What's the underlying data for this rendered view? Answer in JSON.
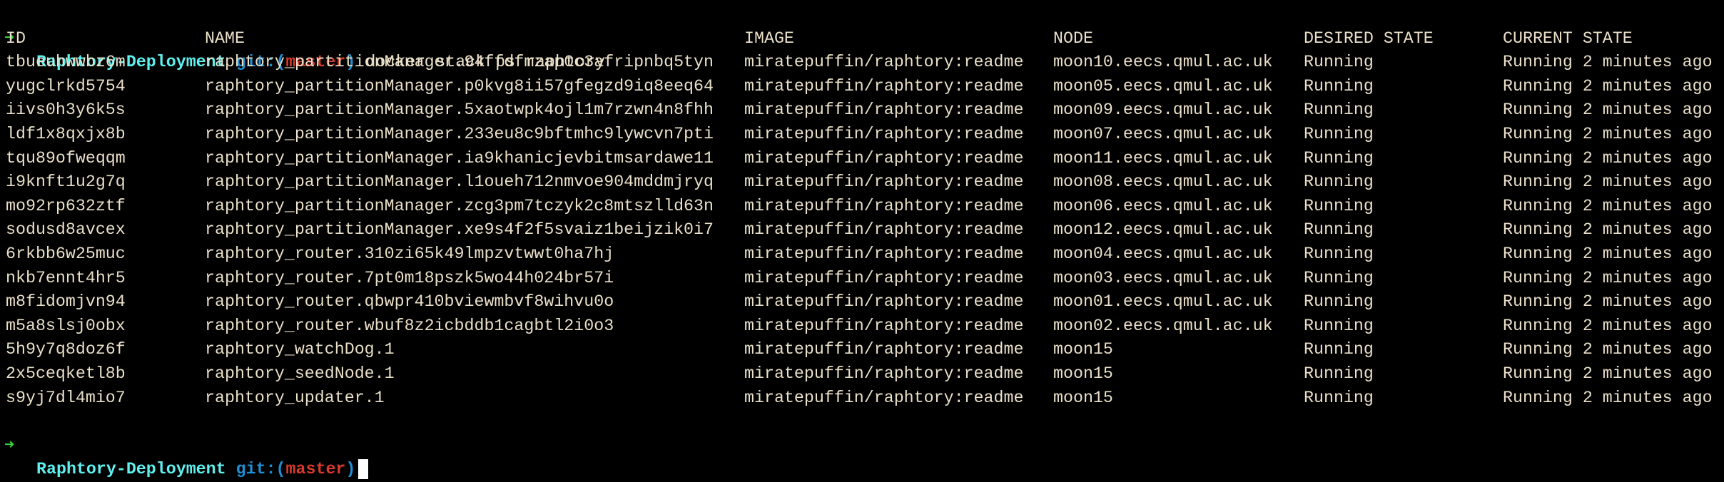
{
  "prompt": {
    "arrow_icon": "right-arrow-icon",
    "directory": "Raphtory-Deployment",
    "git_prefix": "git:(",
    "branch": "master",
    "git_suffix": ")",
    "command": "docker stack ps raphtory"
  },
  "colors": {
    "text": "#eadfc8",
    "arrow": "#3bd13b",
    "directory": "#5ff0f0",
    "git": "#1e90d6",
    "branch": "#d83a2a"
  },
  "table": {
    "headers": [
      "ID",
      "NAME",
      "IMAGE",
      "NODE",
      "DESIRED STATE",
      "CURRENT STATE"
    ],
    "rows": [
      [
        "tbueuhwwbz6m",
        "raphtory_partitionManager.94ffdfmzap0c3afripnbq5tyn",
        "miratepuffin/raphtory:readme",
        "moon10.eecs.qmul.ac.uk",
        "Running",
        "Running 2 minutes ago"
      ],
      [
        "yugclrkd5754",
        "raphtory_partitionManager.p0kvg8ii57gfegzd9iq8eeq64",
        "miratepuffin/raphtory:readme",
        "moon05.eecs.qmul.ac.uk",
        "Running",
        "Running 2 minutes ago"
      ],
      [
        "iivs0h3y6k5s",
        "raphtory_partitionManager.5xaotwpk4ojl1m7rzwn4n8fhh",
        "miratepuffin/raphtory:readme",
        "moon09.eecs.qmul.ac.uk",
        "Running",
        "Running 2 minutes ago"
      ],
      [
        "ldf1x8qxjx8b",
        "raphtory_partitionManager.233eu8c9bftmhc9lywcvn7pti",
        "miratepuffin/raphtory:readme",
        "moon07.eecs.qmul.ac.uk",
        "Running",
        "Running 2 minutes ago"
      ],
      [
        "tqu89ofweqqm",
        "raphtory_partitionManager.ia9khanicjevbitmsardawe11",
        "miratepuffin/raphtory:readme",
        "moon11.eecs.qmul.ac.uk",
        "Running",
        "Running 2 minutes ago"
      ],
      [
        "i9knft1u2g7q",
        "raphtory_partitionManager.l1oueh712nmvoe904mddmjryq",
        "miratepuffin/raphtory:readme",
        "moon08.eecs.qmul.ac.uk",
        "Running",
        "Running 2 minutes ago"
      ],
      [
        "mo92rp632ztf",
        "raphtory_partitionManager.zcg3pm7tczyk2c8mtszlld63n",
        "miratepuffin/raphtory:readme",
        "moon06.eecs.qmul.ac.uk",
        "Running",
        "Running 2 minutes ago"
      ],
      [
        "sodusd8avcex",
        "raphtory_partitionManager.xe9s4f2f5svaiz1beijzik0i7",
        "miratepuffin/raphtory:readme",
        "moon12.eecs.qmul.ac.uk",
        "Running",
        "Running 2 minutes ago"
      ],
      [
        "6rkbb6w25muc",
        "raphtory_router.310zi65k49lmpzvtwwt0ha7hj",
        "miratepuffin/raphtory:readme",
        "moon04.eecs.qmul.ac.uk",
        "Running",
        "Running 2 minutes ago"
      ],
      [
        "nkb7ennt4hr5",
        "raphtory_router.7pt0m18pszk5wo44h024br57i",
        "miratepuffin/raphtory:readme",
        "moon03.eecs.qmul.ac.uk",
        "Running",
        "Running 2 minutes ago"
      ],
      [
        "m8fidomjvn94",
        "raphtory_router.qbwpr410bviewmbvf8wihvu0o",
        "miratepuffin/raphtory:readme",
        "moon01.eecs.qmul.ac.uk",
        "Running",
        "Running 2 minutes ago"
      ],
      [
        "m5a8slsj0obx",
        "raphtory_router.wbuf8z2icbddb1cagbtl2i0o3",
        "miratepuffin/raphtory:readme",
        "moon02.eecs.qmul.ac.uk",
        "Running",
        "Running 2 minutes ago"
      ],
      [
        "5h9y7q8doz6f",
        "raphtory_watchDog.1",
        "miratepuffin/raphtory:readme",
        "moon15",
        "Running",
        "Running 2 minutes ago"
      ],
      [
        "2x5ceqketl8b",
        "raphtory_seedNode.1",
        "miratepuffin/raphtory:readme",
        "moon15",
        "Running",
        "Running 2 minutes ago"
      ],
      [
        "s9yj7dl4mio7",
        "raphtory_updater.1",
        "miratepuffin/raphtory:readme",
        "moon15",
        "Running",
        "Running 2 minutes ago"
      ]
    ]
  }
}
